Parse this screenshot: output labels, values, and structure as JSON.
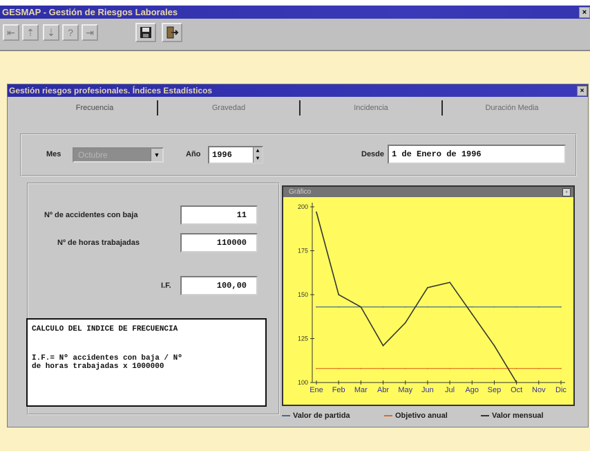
{
  "app": {
    "title": "GESMAP - Gestión de Riesgos Laborales",
    "close_glyph": "×"
  },
  "toolbar": {
    "buttons": [
      "first-record",
      "previous-record",
      "next-record",
      "help",
      "last-record",
      "save",
      "exit"
    ],
    "glyphs": [
      "⇤",
      "⇡",
      "⇣",
      "?",
      "⇥",
      "▣",
      "⇱"
    ]
  },
  "window": {
    "title": "Gestión riesgos profesionales. Índices Estadísticos",
    "close_glyph": "×",
    "tabs": [
      "Frecuencia",
      "Gravedad",
      "Incidencia",
      "Duración Media"
    ],
    "selected_tab": 0
  },
  "filters": {
    "mes_label": "Mes",
    "mes_value": "Octubre",
    "anio_label": "Año",
    "anio_value": "1996",
    "desde_label": "Desde",
    "desde_value": "1 de Enero de 1996"
  },
  "stats": {
    "accidentes_label": "Nº de accidentes con baja",
    "accidentes_value": "11",
    "horas_label": "Nº de horas trabajadas",
    "horas_value": "110000",
    "if_label": "I.F.",
    "if_value": "100,00"
  },
  "formula": {
    "title": "CALCULO DEL INDICE DE FRECUENCIA",
    "line1": "I.F.=  Nº  accidentes con baja / Nº",
    "line2": "de horas trabajadas x 1000000"
  },
  "chart_window": {
    "title": "Gráfico",
    "max_glyph": "▫"
  },
  "chart_data": {
    "type": "line",
    "categories": [
      "Ene",
      "Feb",
      "Mar",
      "Abr",
      "May",
      "Jun",
      "Jul",
      "Ago",
      "Sep",
      "Oct",
      "Nov",
      "Dic"
    ],
    "ylim": [
      100,
      200
    ],
    "yticks": [
      "200",
      "175",
      "150",
      "125",
      "100"
    ],
    "series": [
      {
        "name": "Valor de partida",
        "color": "#4a6a8a",
        "values": [
          143,
          143,
          143,
          143,
          143,
          143,
          143,
          143,
          143,
          143,
          143,
          143
        ]
      },
      {
        "name": "Objetivo anual",
        "color": "#e06a1a",
        "values": [
          108,
          108,
          108,
          108,
          108,
          108,
          108,
          108,
          108,
          108,
          108,
          108
        ]
      },
      {
        "name": "Valor mensual",
        "color": "#333333",
        "values": [
          197,
          150,
          143,
          121,
          134,
          154,
          157,
          139,
          121,
          100,
          null,
          null
        ]
      }
    ]
  },
  "colors": {
    "app_background": "#fbf1c2",
    "chart_background": "#fffb5e",
    "titlebar": "#2f2fa8"
  }
}
